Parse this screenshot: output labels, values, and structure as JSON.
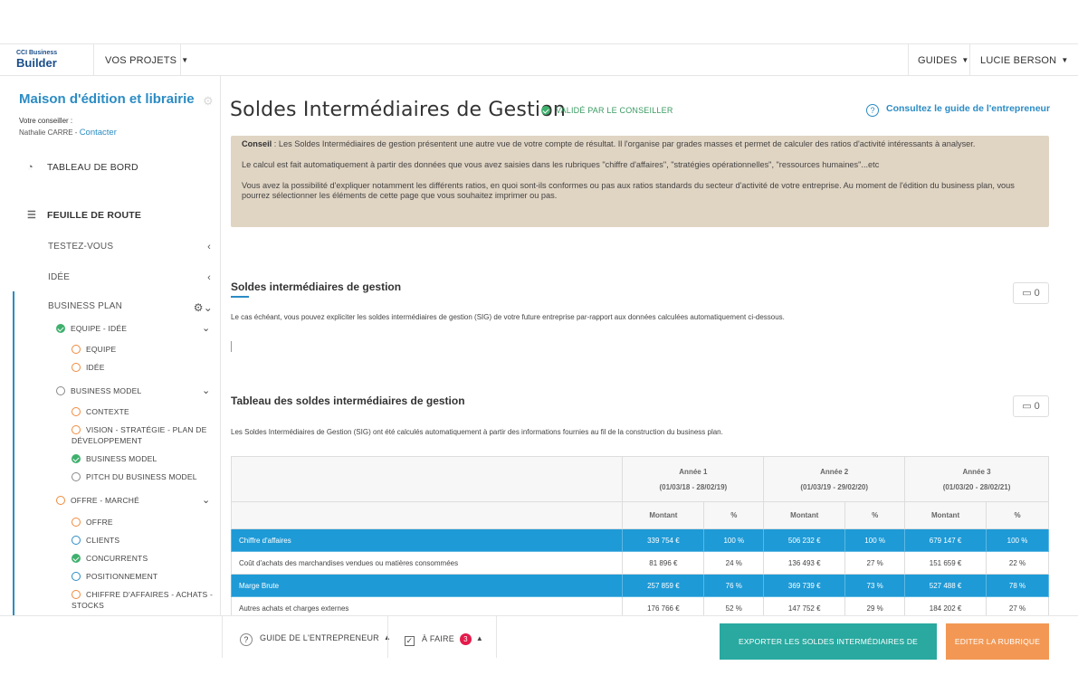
{
  "header": {
    "logo_line1": "CCI Business",
    "logo_line2": "Builder",
    "projects_label": "VOS PROJETS",
    "guides_label": "GUIDES",
    "user_label": "LUCIE BERSON"
  },
  "sidebar": {
    "project_title": "Maison d'édition et librairie",
    "advisor_label": "Votre conseiller :",
    "advisor_name": "Nathalie CARRE",
    "contact_label": "Contacter",
    "dashboard_label": "TABLEAU DE BORD",
    "roadmap_label": "FEUILLE DE ROUTE",
    "testez_label": "TESTEZ-VOUS",
    "idee_label": "IDÉE",
    "bp_label": "BUSINESS PLAN",
    "sub": {
      "equipe_idee": "EQUIPE - IDÉE",
      "equipe": "EQUIPE",
      "idee": "IDÉE",
      "business_model": "BUSINESS MODEL",
      "contexte": "CONTEXTE",
      "vision_1": "VISION - STRATÉGIE - PLAN DE",
      "vision_2": "DÉVELOPPEMENT",
      "business_model_item": "BUSINESS MODEL",
      "pitch": "PITCH DU BUSINESS MODEL",
      "offre_marche": "OFFRE - MARCHÉ",
      "offre": "OFFRE",
      "clients": "CLIENTS",
      "concurrents": "CONCURRENTS",
      "positionnement": "POSITIONNEMENT",
      "chiffre_1": "CHIFFRE D'AFFAIRES - ACHATS -",
      "chiffre_2": "STOCKS"
    }
  },
  "main": {
    "title": "Soldes Intermédiaires de Gestion",
    "validated_label": "VALIDÉ PAR LE CONSEILLER",
    "guide_link": "Consultez le guide de l'entrepreneur",
    "conseil": {
      "label": "Conseil",
      "p1": " : Les Soldes Intermédiaires de gestion présentent une autre vue de votre compte de résultat. Il l'organise par grades masses et permet de calculer des ratios d'activité intéressants à analyser.",
      "p2": "Le calcul est fait automatiquement à partir des données que vous avez saisies dans les rubriques \"chiffre d'affaires\", \"stratégies opérationnelles\", \"ressources humaines\"...etc",
      "p3": "Vous avez la possibilité d'expliquer notamment les différents ratios, en quoi sont-ils conformes ou pas aux ratios standards du secteur d'activité de votre entreprise. Au moment de l'édition du business plan, vous pourrez sélectionner les éléments de cette page que vous souhaitez imprimer ou pas."
    },
    "section1": {
      "title": "Soldes intermédiaires de gestion",
      "comments": "0",
      "desc": "Le cas échéant, vous pouvez expliciter les soldes intermédiaires de gestion (SIG) de votre future entreprise par-rapport aux données calculées automatiquement ci-dessous."
    },
    "section2": {
      "title": "Tableau des soldes intermédiaires de gestion",
      "comments": "0",
      "desc": "Les Soldes Intermédiaires de Gestion (SIG) ont été calculés automatiquement à partir des informations fournies au fil de la construction du business plan."
    },
    "table": {
      "years": [
        {
          "label": "Année 1",
          "period": "(01/03/18 - 28/02/19)"
        },
        {
          "label": "Année 2",
          "period": "(01/03/19 - 29/02/20)"
        },
        {
          "label": "Année 3",
          "period": "(01/03/20 - 28/02/21)"
        }
      ],
      "col_amount": "Montant",
      "col_pct": "%",
      "rows": [
        {
          "label": "Chiffre d'affaires",
          "values": [
            "339 754 €",
            "100 %",
            "506 232 €",
            "100 %",
            "679 147 €",
            "100 %"
          ]
        },
        {
          "label": "Coût d'achats des marchandises vendues ou matières consommées",
          "values": [
            "81 896 €",
            "24 %",
            "136 493 €",
            "27 %",
            "151 659 €",
            "22 %"
          ]
        },
        {
          "label": "Marge Brute",
          "values": [
            "257 859 €",
            "76 %",
            "369 739 €",
            "73 %",
            "527 488 €",
            "78 %"
          ]
        },
        {
          "label": "Autres achats et charges externes",
          "values": [
            "176 766 €",
            "52 %",
            "147 752 €",
            "29 %",
            "184 202 €",
            "27 %"
          ]
        }
      ]
    }
  },
  "footer": {
    "guide_label": "GUIDE DE L'ENTREPRENEUR",
    "todo_label": "À FAIRE",
    "todo_count": "3",
    "export_label": "EXPORTER LES SOLDES INTERMÉDIAIRES DE GESTION",
    "edit_label": "EDITER LA RUBRIQUE"
  },
  "colors": {
    "brand_blue": "#2b8cc4",
    "row_highlight": "#1e9ad6",
    "validated_green": "#3fb06d",
    "export_teal": "#29a9a0",
    "edit_orange": "#f39854",
    "advice_bg": "#e0d4c3"
  }
}
